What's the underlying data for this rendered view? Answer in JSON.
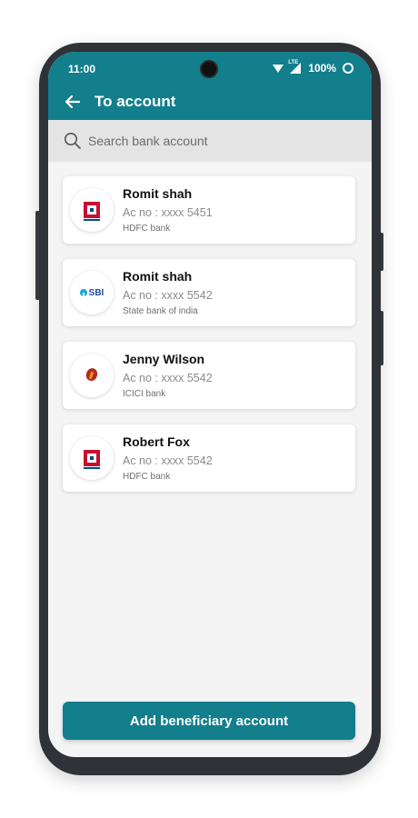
{
  "status_bar": {
    "time": "11:00",
    "network": "LTE",
    "battery": "100%"
  },
  "app_bar": {
    "title": "To account",
    "back_icon": "arrow-left-icon"
  },
  "search": {
    "placeholder": "Search bank account",
    "value": "",
    "icon": "search-icon"
  },
  "accounts": [
    {
      "name": "Romit shah",
      "account": "Ac no : xxxx 5451",
      "bank": "HDFC bank",
      "logo": "hdfc-logo-icon"
    },
    {
      "name": "Romit shah",
      "account": "Ac no : xxxx 5542",
      "bank": "State bank of india",
      "logo": "sbi-logo-icon",
      "logo_text": "SBI"
    },
    {
      "name": "Jenny Wilson",
      "account": "Ac no : xxxx 5542",
      "bank": "ICICI bank",
      "logo": "icici-logo-icon"
    },
    {
      "name": "Robert Fox",
      "account": "Ac no : xxxx 5542",
      "bank": "HDFC bank",
      "logo": "hdfc-logo-icon"
    }
  ],
  "action": {
    "label": "Add beneficiary account"
  },
  "colors": {
    "primary": "#137e8c",
    "background": "#f4f4f5",
    "search_bg": "#e4e4e4",
    "text_muted": "#8a8a8a"
  }
}
